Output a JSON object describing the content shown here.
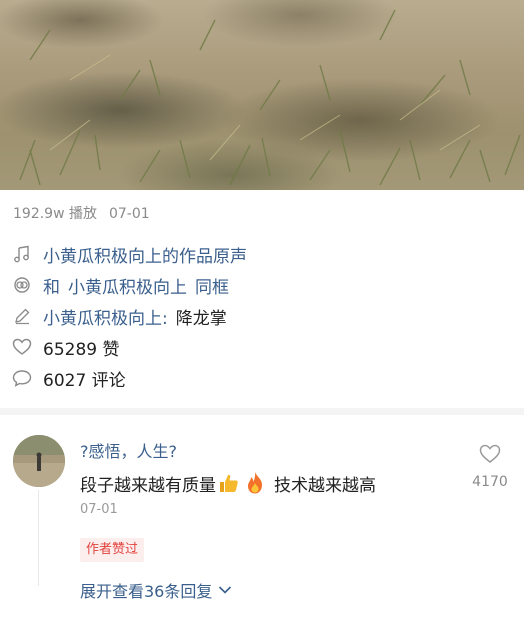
{
  "video": {
    "play_count": "192.9w 播放",
    "date": "07-01"
  },
  "info": {
    "sound": "小黄瓜积极向上的作品原声",
    "duet_prefix": "和",
    "duet_user": "小黄瓜积极向上",
    "duet_suffix": "同框",
    "title_user": "小黄瓜积极向上:",
    "title_text": "降龙掌",
    "likes": "65289 赞",
    "comments": "6027 评论"
  },
  "comment": {
    "user": "?感悟，人生?",
    "text_before": "段子越来越有质量",
    "text_after": "技术越来越高",
    "emojis": [
      "thumbs-up-emoji",
      "fire-emoji"
    ],
    "date": "07-01",
    "author_badge": "作者赞过",
    "expand_replies": "展开查看36条回复",
    "like_count": "4170"
  },
  "colors": {
    "link_blue": "#3a5f8c",
    "badge_red": "#e2423d",
    "badge_bg": "#fdeeee"
  }
}
